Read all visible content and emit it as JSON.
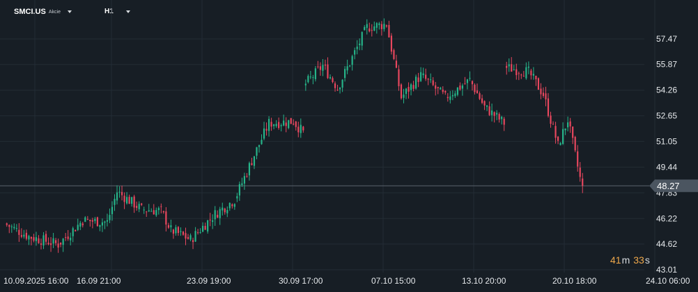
{
  "toolbar": {
    "symbol": "SMCI.US",
    "asset_class": "Akcie",
    "timeframe": "H1",
    "symbol_caret": "chevron-down-icon",
    "timeframe_caret": "chevron-down-icon"
  },
  "countdown": {
    "minutes": "41",
    "minutes_unit": "m",
    "seconds": "33",
    "seconds_unit": "s"
  },
  "colors": {
    "background": "#171e25",
    "grid": "#232c35",
    "up": "#26b58a",
    "down": "#e8475e",
    "price_line": "#5a636c",
    "label_bg": "#4b5560",
    "axis_text": "#e6e9ec",
    "countdown": "#f0a94b"
  },
  "chart_data": {
    "type": "candlestick",
    "title": "",
    "ylim": [
      43.01,
      59.0
    ],
    "y_ticks": [
      43.01,
      44.62,
      46.22,
      47.83,
      49.44,
      51.05,
      52.65,
      54.26,
      55.87,
      57.47
    ],
    "y_tick_labels": [
      "43.01",
      "44.62",
      "46.22",
      "47.83",
      "49.44",
      "51.05",
      "52.65",
      "54.26",
      "55.87",
      "57.47"
    ],
    "x_tick_labels": [
      "10.09.2025  16:00",
      "16.09  21:00",
      "23.09  19:00",
      "30.09  17:00",
      "07.10  15:00",
      "13.10  20:00",
      "20.10  18:00",
      "24.10  06:00"
    ],
    "last_price": 48.27,
    "last_price_label": "48.27",
    "grid": true,
    "segments": [
      {
        "from": 45.9,
        "to": 45.1,
        "bars": 10
      },
      {
        "from": 45.1,
        "to": 44.6,
        "bars": 12
      },
      {
        "from": 44.6,
        "to": 46.1,
        "bars": 10
      },
      {
        "from": 46.1,
        "to": 46.0,
        "bars": 10
      },
      {
        "from": 46.0,
        "to": 47.9,
        "bars": 4
      },
      {
        "from": 47.9,
        "to": 46.8,
        "bars": 10
      },
      {
        "from": 46.8,
        "to": 46.7,
        "bars": 8
      },
      {
        "from": 46.7,
        "to": 45.5,
        "bars": 4
      },
      {
        "from": 45.5,
        "to": 44.9,
        "bars": 8
      },
      {
        "from": 44.9,
        "to": 46.5,
        "bars": 10
      },
      {
        "from": 46.5,
        "to": 47.4,
        "bars": 8
      },
      {
        "from": 47.4,
        "to": 50.2,
        "bars": 8
      },
      {
        "from": 50.2,
        "to": 52.2,
        "bars": 6
      },
      {
        "from": 52.2,
        "to": 52.3,
        "bars": 10
      },
      {
        "from": 52.3,
        "to": 51.6,
        "bars": 4
      },
      {
        "from": 54.5,
        "to": 55.8,
        "bars": 8
      },
      {
        "from": 55.8,
        "to": 54.4,
        "bars": 6
      },
      {
        "from": 54.4,
        "to": 58.2,
        "bars": 12
      },
      {
        "from": 58.2,
        "to": 58.4,
        "bars": 8
      },
      {
        "from": 58.4,
        "to": 53.8,
        "bars": 6
      },
      {
        "from": 53.8,
        "to": 55.2,
        "bars": 8
      },
      {
        "from": 55.2,
        "to": 53.8,
        "bars": 10
      },
      {
        "from": 53.8,
        "to": 54.9,
        "bars": 10
      },
      {
        "from": 54.9,
        "to": 53.2,
        "bars": 6
      },
      {
        "from": 53.2,
        "to": 52.2,
        "bars": 8
      },
      {
        "from": 55.7,
        "to": 55.4,
        "bars": 10
      },
      {
        "from": 55.4,
        "to": 54.0,
        "bars": 6
      },
      {
        "from": 54.0,
        "to": 50.8,
        "bars": 6
      },
      {
        "from": 50.8,
        "to": 52.4,
        "bars": 4
      },
      {
        "from": 52.4,
        "to": 48.0,
        "bars": 6
      }
    ]
  }
}
